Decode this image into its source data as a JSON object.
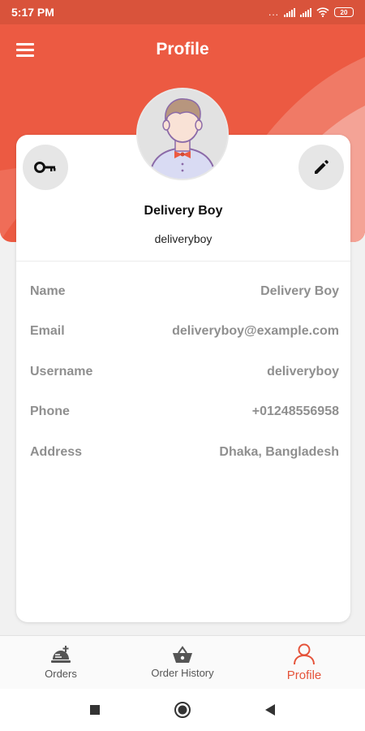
{
  "status_bar": {
    "time": "5:17 PM",
    "dots": "...",
    "battery": "20"
  },
  "app_bar": {
    "title": "Profile"
  },
  "profile": {
    "name": "Delivery Boy",
    "username": "deliveryboy"
  },
  "info": [
    {
      "label": "Name",
      "value": "Delivery Boy"
    },
    {
      "label": "Email",
      "value": "deliveryboy@example.com"
    },
    {
      "label": "Username",
      "value": "deliveryboy"
    },
    {
      "label": "Phone",
      "value": "+01248556958"
    },
    {
      "label": "Address",
      "value": "Dhaka, Bangladesh"
    }
  ],
  "bottom_nav": {
    "items": [
      {
        "label": "Orders",
        "icon": "food-tray-icon"
      },
      {
        "label": "Order History",
        "icon": "basket-icon"
      },
      {
        "label": "Profile",
        "icon": "person-icon",
        "active": true
      }
    ]
  },
  "colors": {
    "primary": "#ec5a42",
    "status_bar": "#d9533b",
    "active_nav": "#e5533a"
  }
}
